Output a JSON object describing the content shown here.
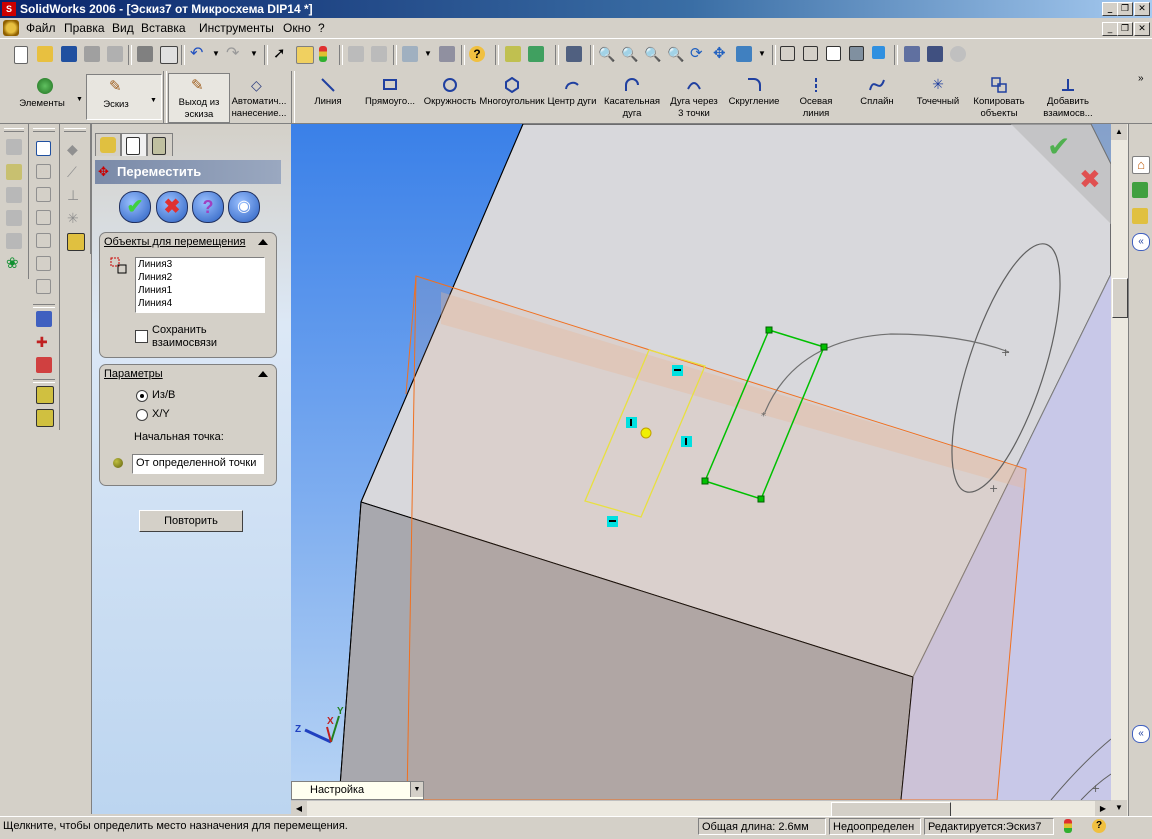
{
  "window": {
    "title": "SolidWorks 2006 - [Эскиз7 от Микросхема DIP14 *]"
  },
  "menu": {
    "items": [
      "Файл",
      "Правка",
      "Вид",
      "Вставка",
      "Инструменты",
      "Окно",
      "?"
    ]
  },
  "command_manager": {
    "tabs": [
      {
        "label": "Элементы"
      },
      {
        "label": "Эскиз"
      }
    ],
    "commands": [
      {
        "label1": "Выход из",
        "label2": "эскиза"
      },
      {
        "label1": "Автоматич...",
        "label2": "нанесение..."
      },
      {
        "label1": "Линия",
        "label2": ""
      },
      {
        "label1": "Прямоуго...",
        "label2": ""
      },
      {
        "label1": "Окружность",
        "label2": ""
      },
      {
        "label1": "Многоугольник",
        "label2": ""
      },
      {
        "label1": "Центр дуги",
        "label2": ""
      },
      {
        "label1": "Касательная",
        "label2": "дуга"
      },
      {
        "label1": "Дуга через",
        "label2": "3 точки"
      },
      {
        "label1": "Скругление",
        "label2": ""
      },
      {
        "label1": "Осевая",
        "label2": "линия"
      },
      {
        "label1": "Сплайн",
        "label2": ""
      },
      {
        "label1": "Точечный",
        "label2": ""
      },
      {
        "label1": "Копировать",
        "label2": "объекты"
      },
      {
        "label1": "Добавить",
        "label2": "взаимосв..."
      }
    ]
  },
  "property_manager": {
    "title": "Переместить",
    "objects_group": {
      "title": "Объекты для перемещения",
      "list": [
        "Линия3",
        "Линия2",
        "Линия1",
        "Линия4"
      ],
      "keep_relations_label1": "Сохранить",
      "keep_relations_label2": "взаимосвязи",
      "keep_relations_checked": false
    },
    "params_group": {
      "title": "Параметры",
      "options": [
        "Из/В",
        "X/Y"
      ],
      "selected_option": "Из/В",
      "start_point_label": "Начальная точка:",
      "start_point_value": "От определенной точки"
    },
    "repeat_button": "Повторить"
  },
  "viewport": {
    "config_dropdown": "Настройка",
    "axes": {
      "x": "X",
      "y": "Y",
      "z": "Z"
    }
  },
  "statusbar": {
    "hint": "Щелкните, чтобы определить место назначения для перемещения.",
    "total_length": "Общая длина: 2.6мм",
    "definition_state": "Недоопределен",
    "editing": "Редактируется:Эскиз7"
  },
  "colors": {
    "title_bar": "#0a246a",
    "panel_bg": "#d4d0c8",
    "ok_green": "#2f9e2f",
    "cancel_red": "#c83030",
    "sketch_green": "#00c000",
    "sketch_yellow": "#e8e040",
    "plane_orange": "#f07020"
  }
}
